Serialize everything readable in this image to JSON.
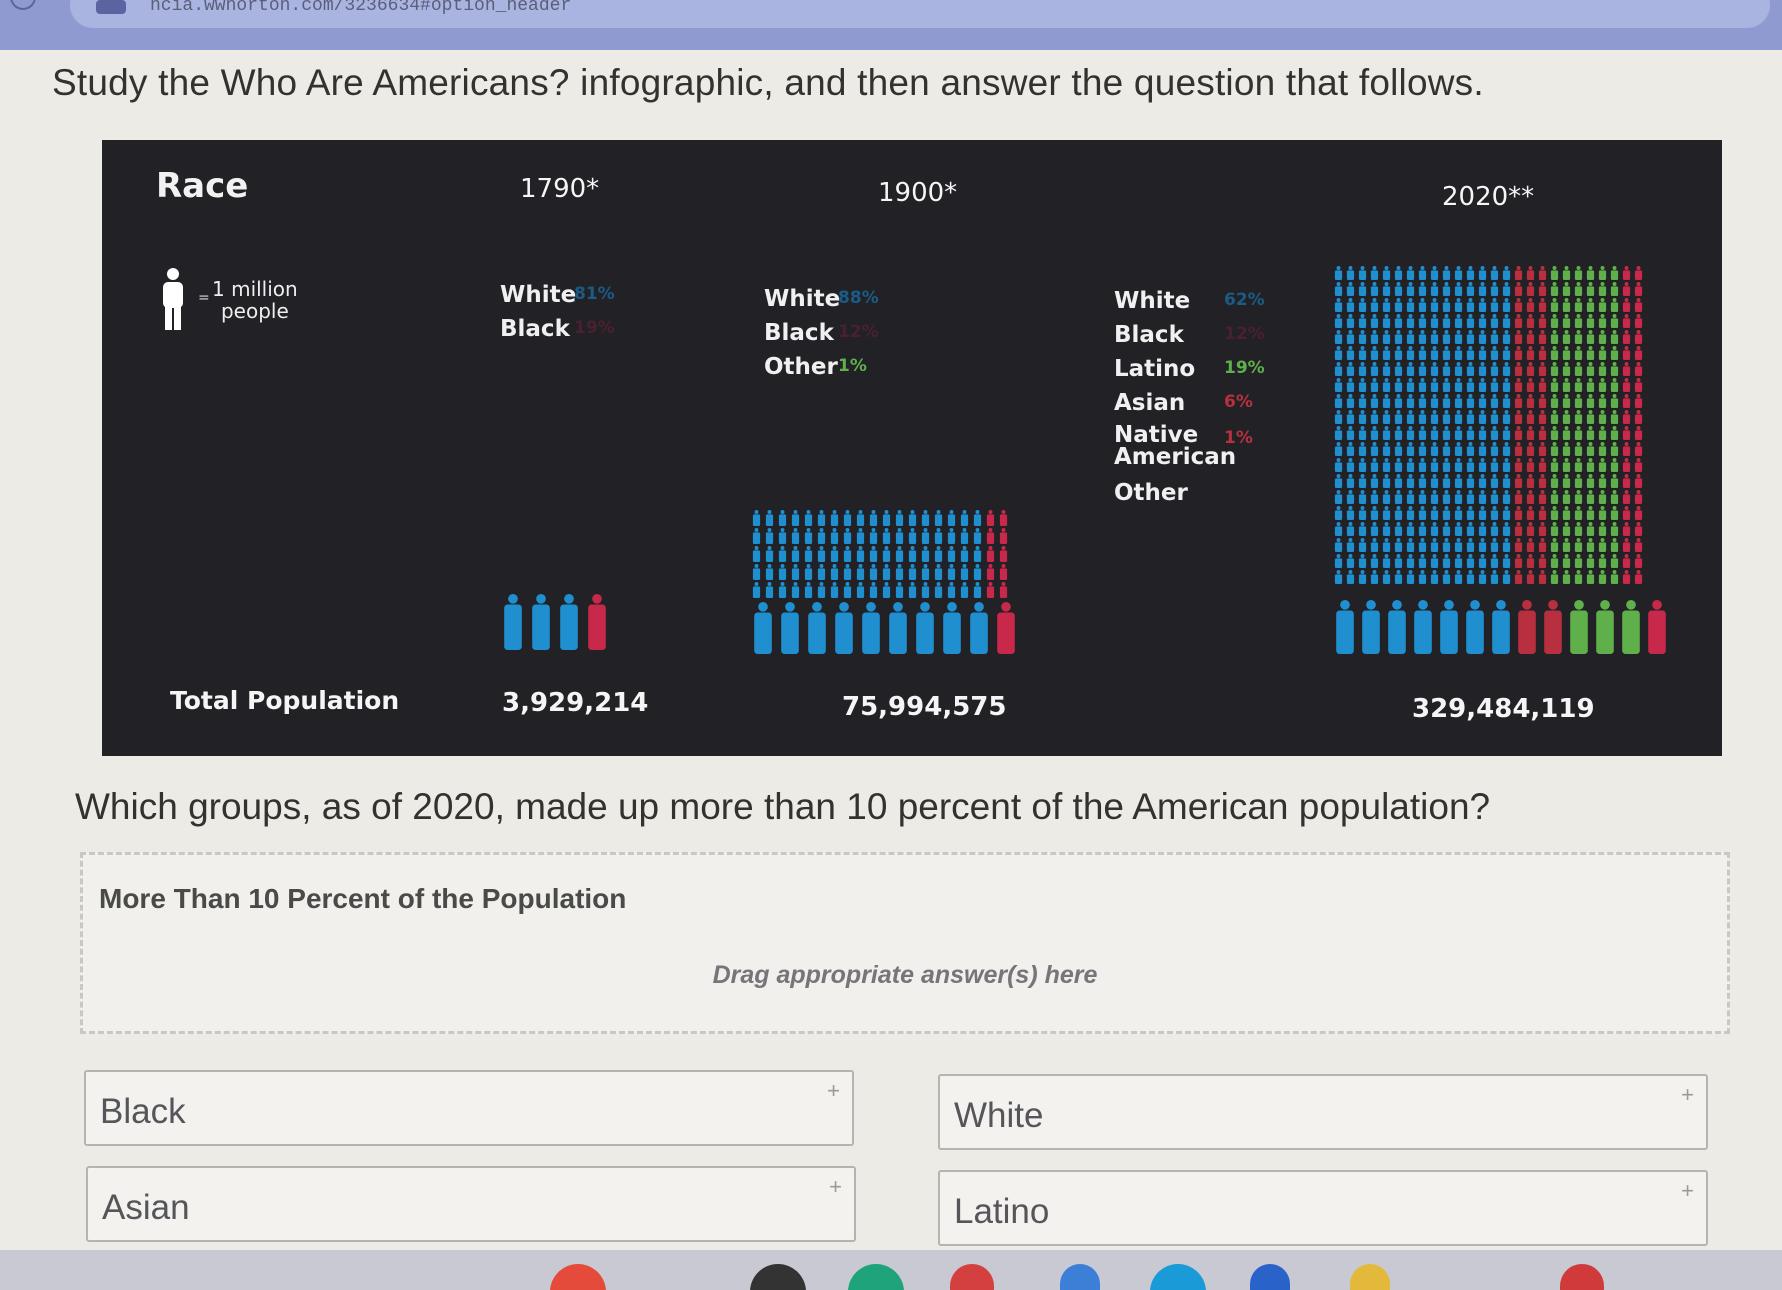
{
  "browser": {
    "url": "ncia.wwnorton.com/3236634#option_header"
  },
  "prompt": "Study the Who Are Americans? infographic, and then answer the question that follows.",
  "infographic": {
    "race_title": "Race",
    "legend_text_1": "1 million",
    "legend_text_2": "people",
    "legend_eq": "=",
    "total_label": "Total Population",
    "years": [
      {
        "label": "1790*",
        "total": "3,929,214"
      },
      {
        "label": "1900*",
        "total": "75,994,575"
      },
      {
        "label": "2020**",
        "total": "329,484,119"
      }
    ],
    "groups_1790": [
      {
        "name": "White",
        "pct": "81%",
        "color": "#1f8fd0"
      },
      {
        "name": "Black",
        "pct": "19%",
        "color": "#7a2a3a"
      }
    ],
    "groups_1900": [
      {
        "name": "White",
        "pct": "88%",
        "color": "#1f8fd0"
      },
      {
        "name": "Black",
        "pct": "12%",
        "color": "#7a2a3a"
      },
      {
        "name": "Other",
        "pct": "1%",
        "color": "#5fb04a"
      }
    ],
    "groups_2020": [
      {
        "name": "White",
        "pct": "62%",
        "color": "#1f8fd0"
      },
      {
        "name": "Black",
        "pct": "12%",
        "color": "#7a2a3a"
      },
      {
        "name": "Latino",
        "pct": "19%",
        "color": "#5fb04a"
      },
      {
        "name": "Asian",
        "pct": "6%",
        "color": "#c0304a"
      },
      {
        "name": "Native",
        "name2": "American",
        "pct": "1%",
        "color": "#c0304a"
      },
      {
        "name": "Other",
        "pct": "",
        "color": "#7a2a3a"
      }
    ],
    "colors": {
      "white": "#1f8fd0",
      "black": "#c8284a",
      "latino": "#5fb04a",
      "asian": "#b83040",
      "background": "#212126"
    }
  },
  "question": "Which groups, as of 2020, made up more than 10 percent of the American population?",
  "dropzone": {
    "title": "More Than 10 Percent of the Population",
    "hint": "Drag appropriate answer(s) here"
  },
  "choices": [
    {
      "label": "Black"
    },
    {
      "label": "White"
    },
    {
      "label": "Asian"
    },
    {
      "label": "Latino"
    }
  ],
  "plus_symbol": "+"
}
